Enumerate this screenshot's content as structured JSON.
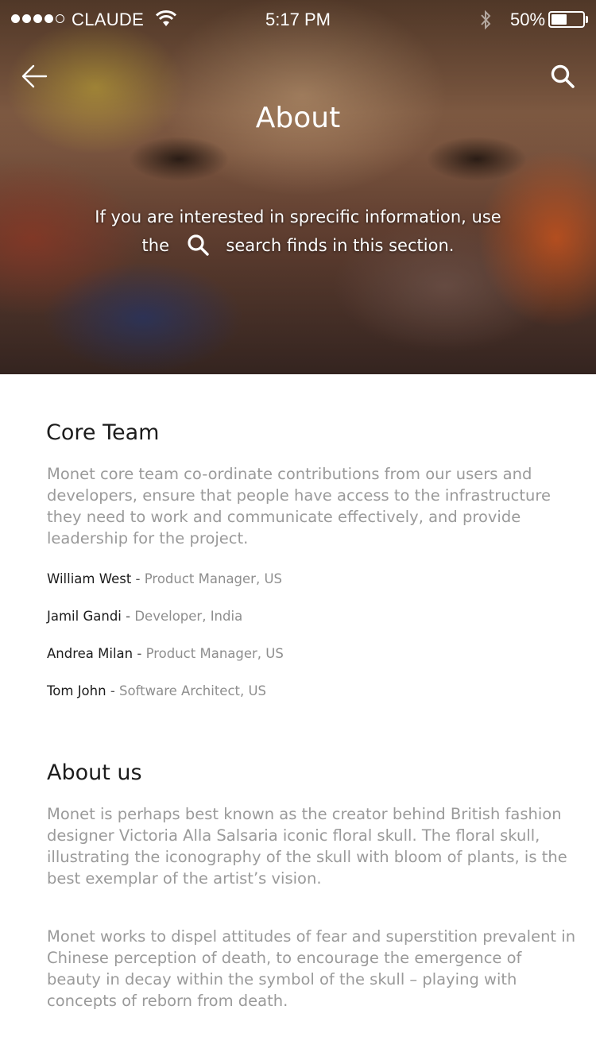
{
  "status_bar": {
    "carrier": "CLAUDE",
    "time": "5:17 PM",
    "battery_percent": "50%",
    "battery_level": 0.5,
    "signal_bars": 4,
    "signal_total": 5
  },
  "header": {
    "title": "About",
    "subtitle_before": "If you are interested in sprecific information, use the",
    "subtitle_after": "search finds in this section.",
    "back_icon": "arrow-left-icon",
    "search_icon": "search-icon"
  },
  "core_team": {
    "title": "Core Team",
    "description": "Monet core team co-ordinate contributions from our users and developers, ensure that people have access to the infrastructure they need to work and communicate effectively, and provide leadership for the project.",
    "members": [
      {
        "name": "William West",
        "separator": " - ",
        "role": "Product Manager, US"
      },
      {
        "name": "Jamil Gandi",
        "separator": " - ",
        "role": "Developer, India"
      },
      {
        "name": "Andrea Milan",
        "separator": " - ",
        "role": "Product Manager, US"
      },
      {
        "name": "Tom John",
        "separator": " - ",
        "role": "Software Architect, US"
      }
    ]
  },
  "about_us": {
    "title": "About us",
    "paragraph_1": "Monet is perhaps best known as the creator behind British fashion designer Victoria Alla Salsaria iconic floral skull. The floral skull, illustrating the iconography of the skull with bloom of plants, is the best exemplar of the artist’s vision.",
    "paragraph_2": "Monet works to dispel attitudes of fear and superstition prevalent in Chinese perception of death, to encourage the emergence of beauty in decay within the symbol of the skull – playing with concepts of reborn from death."
  },
  "colors": {
    "heading": "#1c1c1c",
    "body_text": "#9a9a9a",
    "background": "#ffffff"
  }
}
